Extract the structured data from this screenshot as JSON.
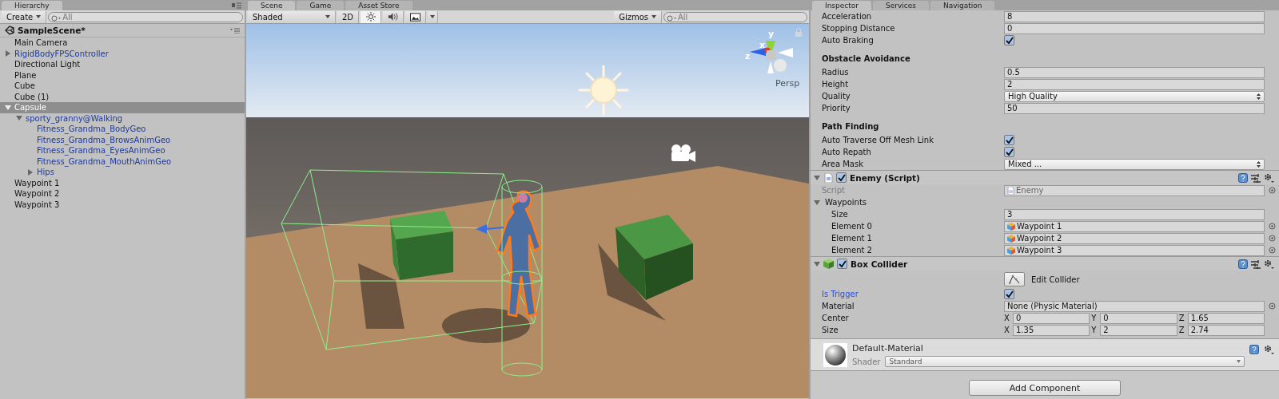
{
  "hierarchy": {
    "tab": "Hierarchy",
    "create_label": "Create",
    "search": {
      "placeholder": "All"
    },
    "scene": {
      "name": "SampleScene*"
    },
    "items": [
      {
        "label": "Main Camera",
        "kind": "object",
        "selected": false
      },
      {
        "label": "RigidBodyFPSController",
        "kind": "prefab",
        "selected": false,
        "expanded": false
      },
      {
        "label": "Directional Light",
        "kind": "object",
        "selected": false
      },
      {
        "label": "Plane",
        "kind": "object",
        "selected": false
      },
      {
        "label": "Cube",
        "kind": "object",
        "selected": false
      },
      {
        "label": "Cube (1)",
        "kind": "object",
        "selected": false
      },
      {
        "label": "Capsule",
        "kind": "object",
        "selected": true,
        "expanded": true,
        "children": [
          {
            "label": "sporty_granny@Walking",
            "kind": "prefab",
            "selected": false,
            "expanded": true,
            "children": [
              {
                "label": "Fitness_Grandma_BodyGeo",
                "kind": "prefab",
                "selected": false
              },
              {
                "label": "Fitness_Grandma_BrowsAnimGeo",
                "kind": "prefab",
                "selected": false
              },
              {
                "label": "Fitness_Grandma_EyesAnimGeo",
                "kind": "prefab",
                "selected": false
              },
              {
                "label": "Fitness_Grandma_MouthAnimGeo",
                "kind": "prefab",
                "selected": false
              },
              {
                "label": "Hips",
                "kind": "prefab",
                "selected": false,
                "expanded": false
              }
            ]
          }
        ]
      },
      {
        "label": "Waypoint 1",
        "kind": "object",
        "selected": false
      },
      {
        "label": "Waypoint 2",
        "kind": "object",
        "selected": false
      },
      {
        "label": "Waypoint 3",
        "kind": "object",
        "selected": false
      }
    ]
  },
  "scene_view": {
    "tabs": [
      {
        "label": "Scene",
        "selected": true
      },
      {
        "label": "Game",
        "selected": false
      },
      {
        "label": "Asset Store",
        "selected": false
      }
    ],
    "toolbar": {
      "draw_mode": "Shaded",
      "mode_2d": {
        "label": "2D",
        "on": false
      },
      "toggles": [
        {
          "kind": "sun",
          "on": true
        },
        {
          "kind": "speaker",
          "on": false
        },
        {
          "kind": "image",
          "on": false
        }
      ],
      "gizmos": "Gizmos",
      "search": {
        "placeholder": "All"
      }
    },
    "gizmo": {
      "axes": [
        "y",
        "x",
        "z"
      ],
      "projection": "Persp"
    }
  },
  "inspector": {
    "tabs": [
      {
        "label": "Inspector",
        "selected": true
      },
      {
        "label": "Services",
        "selected": false
      },
      {
        "label": "Navigation",
        "selected": false
      }
    ],
    "rows": [
      {
        "kind": "field",
        "label": "Acceleration",
        "value": "8"
      },
      {
        "kind": "field",
        "label": "Stopping Distance",
        "value": "0"
      },
      {
        "kind": "check",
        "label": "Auto Braking",
        "checked": true
      },
      {
        "kind": "header",
        "label": "Obstacle Avoidance"
      },
      {
        "kind": "field",
        "label": "Radius",
        "value": "0.5"
      },
      {
        "kind": "field",
        "label": "Height",
        "value": "2"
      },
      {
        "kind": "dropdown",
        "label": "Quality",
        "value": "High Quality"
      },
      {
        "kind": "field",
        "label": "Priority",
        "value": "50"
      },
      {
        "kind": "header",
        "label": "Path Finding"
      },
      {
        "kind": "check",
        "label": "Auto Traverse Off Mesh Link",
        "checked": true
      },
      {
        "kind": "check",
        "label": "Auto Repath",
        "checked": true
      },
      {
        "kind": "dropdown",
        "label": "Area Mask",
        "value": "Mixed ..."
      }
    ],
    "components": [
      {
        "title": "Enemy (Script)",
        "enabled": true,
        "expanded": true,
        "rows": [
          {
            "kind": "script",
            "label": "Script",
            "value": "Enemy"
          },
          {
            "kind": "foldout",
            "label": "Waypoints",
            "expanded": true,
            "children": [
              {
                "kind": "field",
                "label": "Size",
                "value": "3"
              },
              {
                "kind": "object",
                "label": "Element 0",
                "value": "Waypoint 1"
              },
              {
                "kind": "object",
                "label": "Element 1",
                "value": "Waypoint 2"
              },
              {
                "kind": "object",
                "label": "Element 2",
                "value": "Waypoint 3"
              }
            ]
          }
        ]
      },
      {
        "title": "Box Collider",
        "enabled": true,
        "expanded": true,
        "rows": [
          {
            "kind": "button",
            "value": "Edit Collider"
          },
          {
            "kind": "check",
            "label": "Is Trigger",
            "checked": true,
            "overridden": true
          },
          {
            "kind": "material",
            "label": "Material",
            "value": "None (Physic Material)",
            "overridden": false
          },
          {
            "kind": "vector",
            "label": "Center",
            "values": [
              {
                "axis": "X",
                "value": "0"
              },
              {
                "axis": "Y",
                "value": "0"
              },
              {
                "axis": "Z",
                "value": "1.65"
              }
            ],
            "overridden": false
          },
          {
            "kind": "vector",
            "label": "Size",
            "values": [
              {
                "axis": "X",
                "value": "1.35"
              },
              {
                "axis": "Y",
                "value": "2"
              },
              {
                "axis": "Z",
                "value": "2.74"
              }
            ],
            "overridden": false
          }
        ]
      }
    ],
    "material": {
      "name": "Default-Material",
      "shader_label": "Shader",
      "shader": "Standard"
    },
    "add_component": "Add Component"
  }
}
